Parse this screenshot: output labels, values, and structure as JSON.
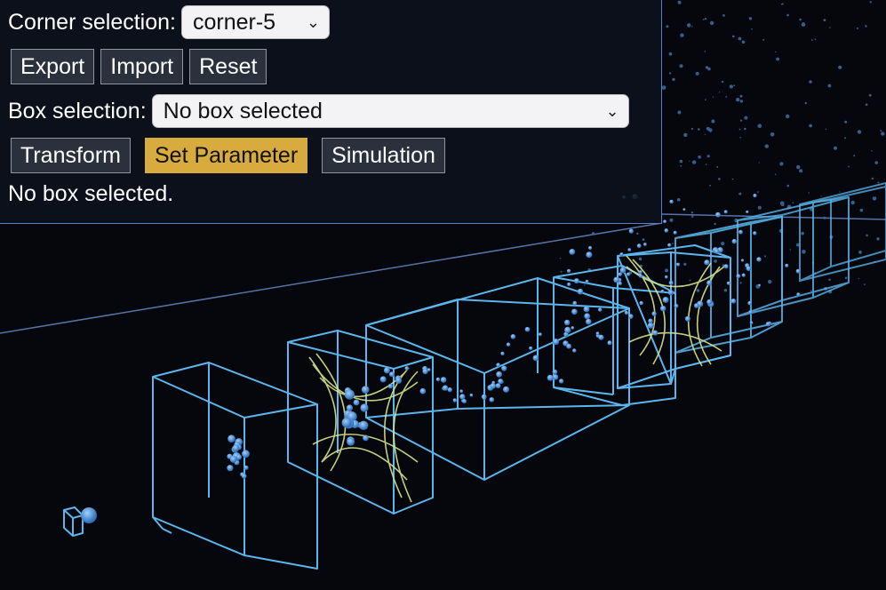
{
  "controls": {
    "corner_label": "Corner selection:",
    "corner_value": "corner-5",
    "buttons": [
      "Export",
      "Import",
      "Reset"
    ],
    "box_label": "Box selection:",
    "box_value": "No box selected",
    "mode_tabs": [
      "Transform",
      "Set Parameter",
      "Simulation"
    ],
    "active_tab": "Set Parameter",
    "status_text": "No box selected."
  },
  "icons": {
    "dropdown": "chevron-down-icon"
  },
  "colors": {
    "background": "#05070d",
    "panel_border": "#5e7fbf",
    "box_wireframe": "#5bb6ee",
    "field_lines": "#d8e38a",
    "particles": "#4d8fd6",
    "active_tab": "#d8ab3f"
  }
}
